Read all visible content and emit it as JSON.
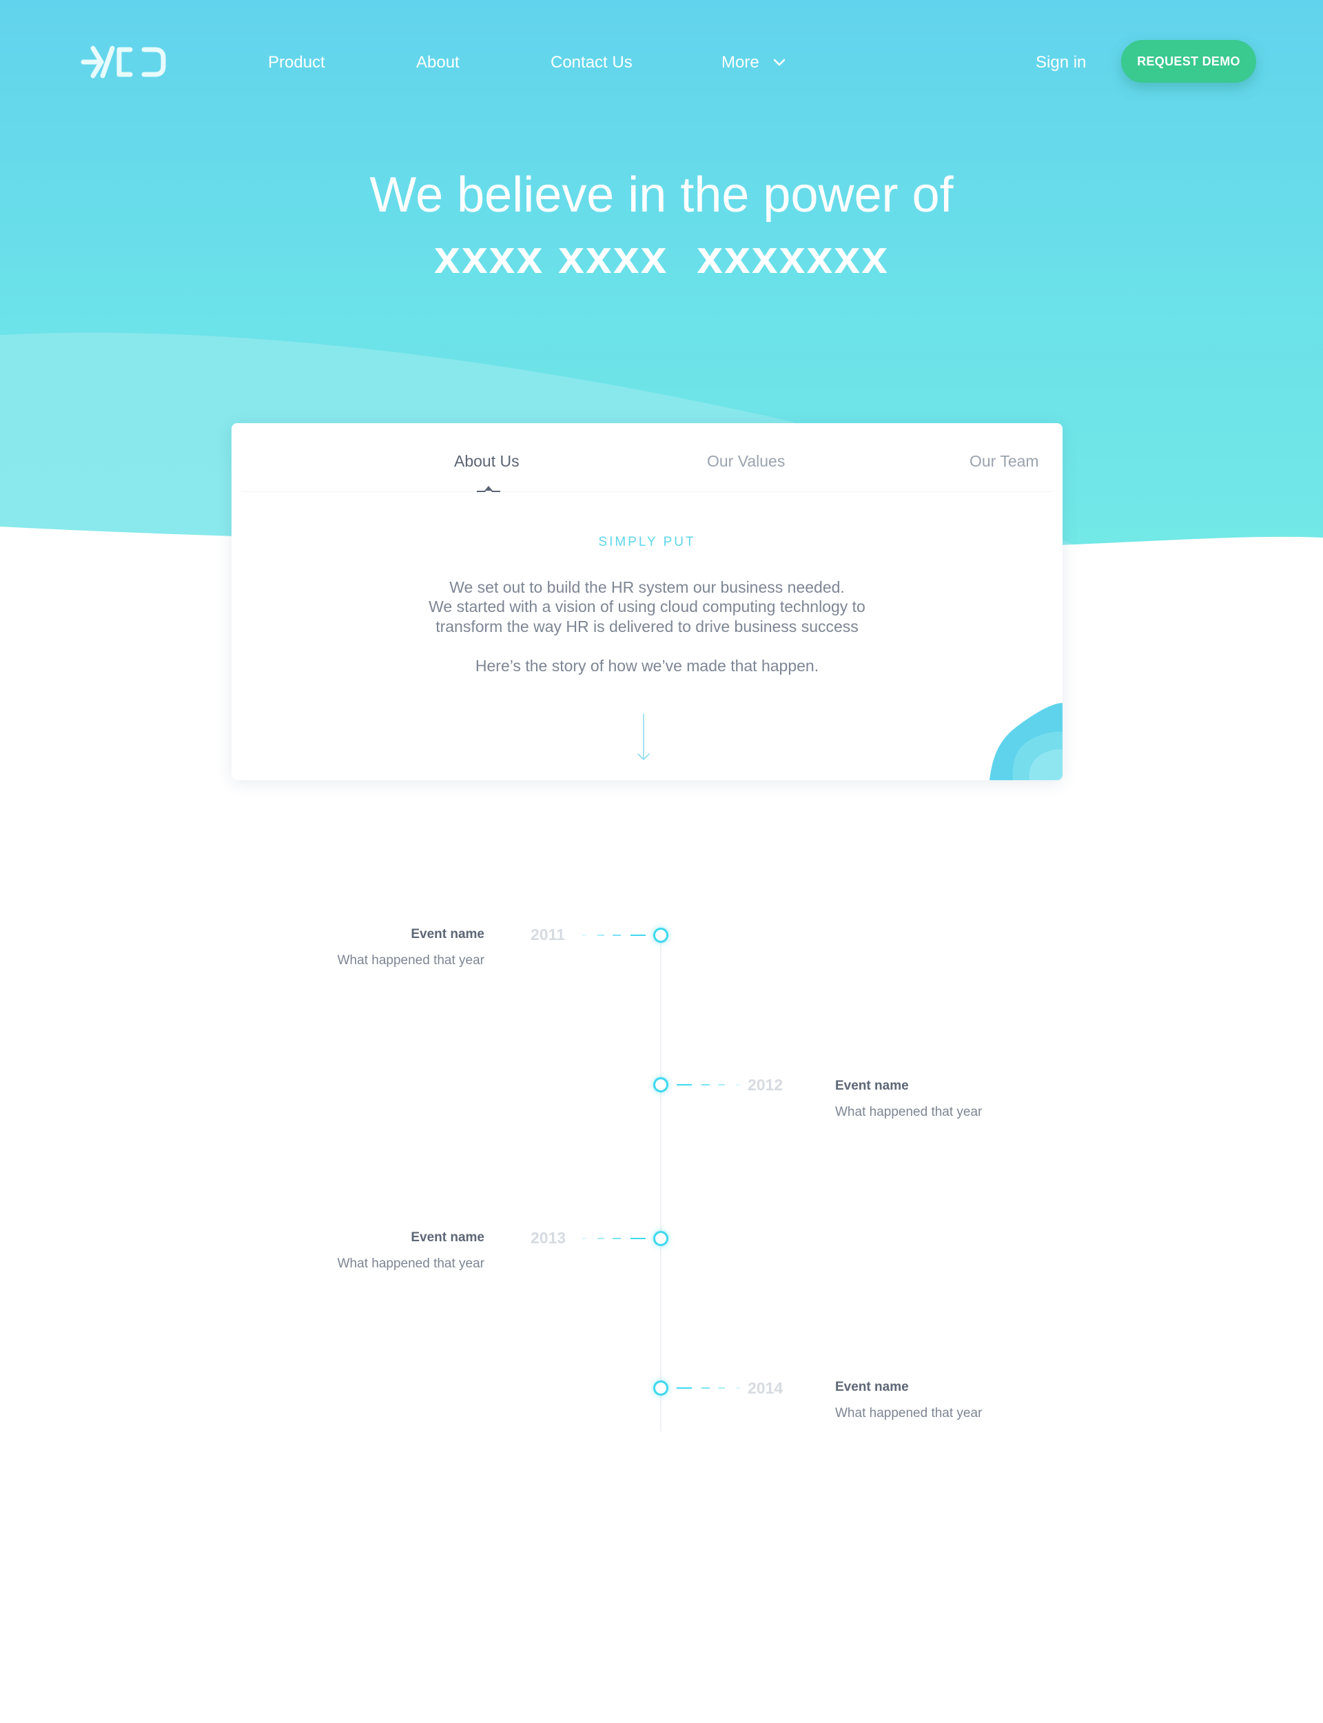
{
  "nav": {
    "logo": "logo",
    "links": [
      "Product",
      "About",
      "Contact Us",
      "More"
    ],
    "signin": "Sign in",
    "cta": "REQUEST DEMO"
  },
  "hero": {
    "title": "We believe in the power of",
    "subtitle": "xxxx xxxx  xxxxxxx"
  },
  "tabs": [
    "About Us",
    "Our Values",
    "Our Team"
  ],
  "active_tab": "About Us",
  "card": {
    "eyebrow": "SIMPLY PUT",
    "paragraph_lines": [
      "We set out to build the HR system our business needed.",
      "We started with a vision of using cloud computing technlogy to",
      "transform the way HR is delivered to drive business success"
    ],
    "story": "Here’s the story of how we’ve made that happen."
  },
  "timeline": [
    {
      "year": "2011",
      "name": "Event name",
      "desc": "What happened that year"
    },
    {
      "year": "2012",
      "name": "Event name",
      "desc": "What happened that year"
    },
    {
      "year": "2013",
      "name": "Event name",
      "desc": "What happened that year"
    },
    {
      "year": "2014",
      "name": "Event name",
      "desc": "What happened that year"
    }
  ],
  "colors": {
    "hero_top": "#62d3ec",
    "hero_bottom": "#72e8e7",
    "cta": "#3ac98f",
    "accent": "#3fd8ee",
    "text_muted": "#7d8694"
  }
}
